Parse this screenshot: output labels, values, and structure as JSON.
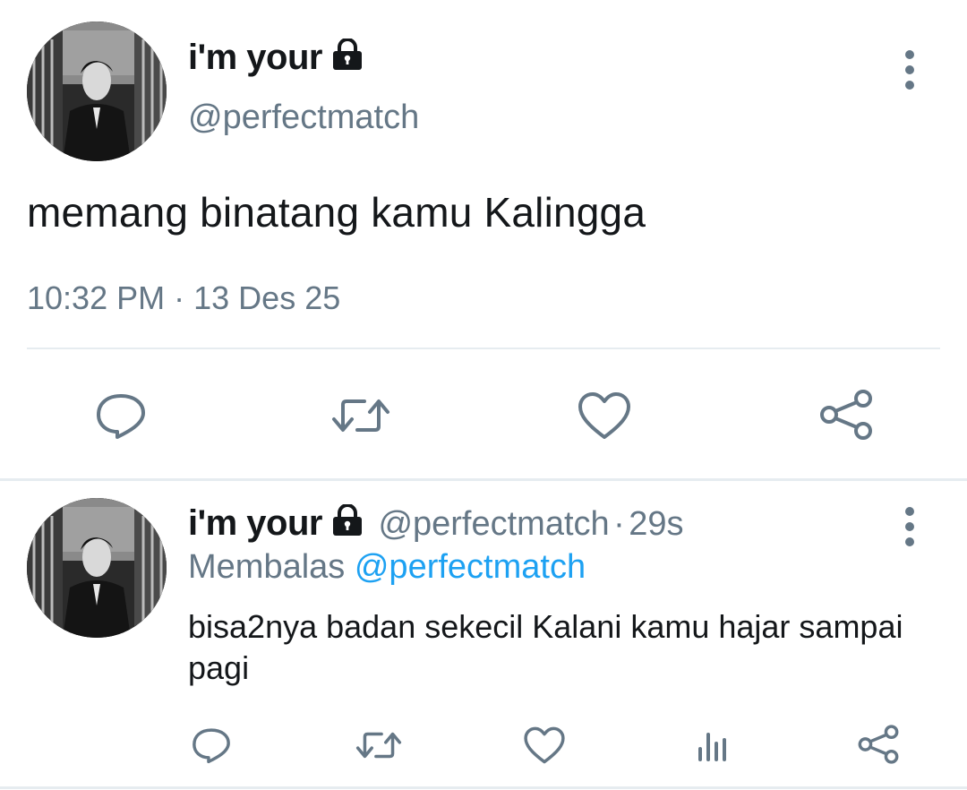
{
  "tweet": {
    "display_name": "i'm your",
    "handle": "@perfectmatch",
    "text": "memang binatang kamu Kalingga",
    "time": "10:32 PM",
    "separator": "·",
    "date": "13 Des 25",
    "avatar_icon": "profile-photo",
    "lock_icon": "lock-icon",
    "more_icon": "more-vertical-icon",
    "actions": [
      "reply-icon",
      "retweet-icon",
      "like-icon",
      "share-icon"
    ]
  },
  "reply": {
    "display_name": "i'm your",
    "handle": "@perfectmatch",
    "separator": "·",
    "age": "29s",
    "replying_label": "Membalas",
    "replying_to": "@perfectmatch",
    "text": "bisa2nya badan sekecil Kalani kamu hajar sampai pagi",
    "actions": [
      "reply-icon",
      "retweet-icon",
      "like-icon",
      "analytics-icon",
      "share-icon"
    ]
  },
  "colors": {
    "text": "#14171a",
    "secondary": "#657786",
    "link": "#1da1f2",
    "divider": "#e6ecf0"
  }
}
